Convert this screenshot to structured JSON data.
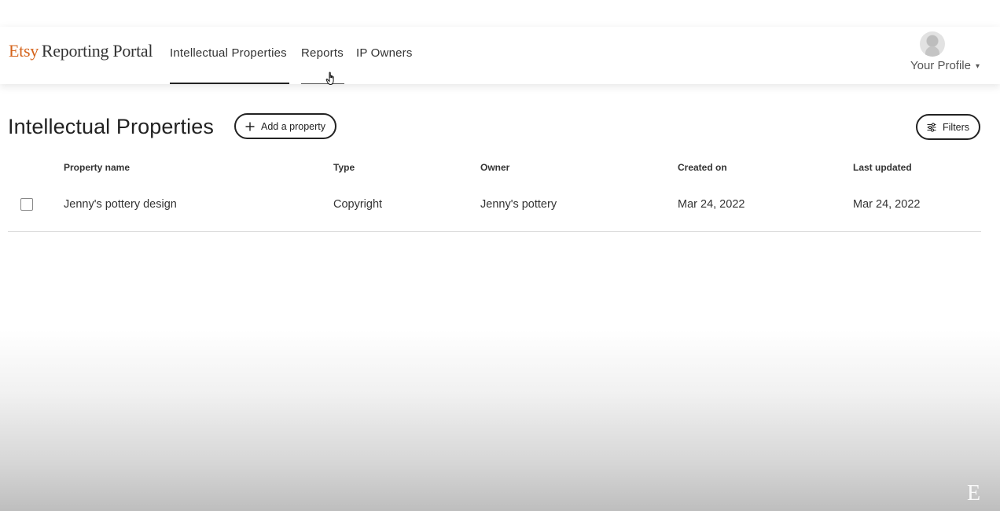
{
  "header": {
    "brand_etsy": "Etsy",
    "brand_portal": "Reporting Portal",
    "tabs": [
      {
        "label": "Intellectual Properties",
        "active": true
      },
      {
        "label": "Reports",
        "active": false
      },
      {
        "label": "IP Owners",
        "active": false
      }
    ],
    "profile_label": "Your Profile",
    "profile_caret": "▾"
  },
  "main": {
    "title": "Intellectual Properties",
    "add_button_label": "Add a property",
    "filters_button_label": "Filters"
  },
  "table": {
    "columns": [
      "Property name",
      "Type",
      "Owner",
      "Created on",
      "Last updated"
    ],
    "rows": [
      {
        "checked": false,
        "property_name": "Jenny's pottery design",
        "type": "Copyright",
        "owner": "Jenny's pottery",
        "created_on": "Mar 24, 2022",
        "last_updated": "Mar 24, 2022"
      }
    ]
  },
  "watermark": "E",
  "colors": {
    "brand": "#d5641c",
    "text": "#222222",
    "divider": "#dddddd"
  },
  "icons": {
    "add": "plus-icon",
    "filters": "sliders-icon",
    "profile": "avatar",
    "cursor": "hand-pointer-icon"
  }
}
